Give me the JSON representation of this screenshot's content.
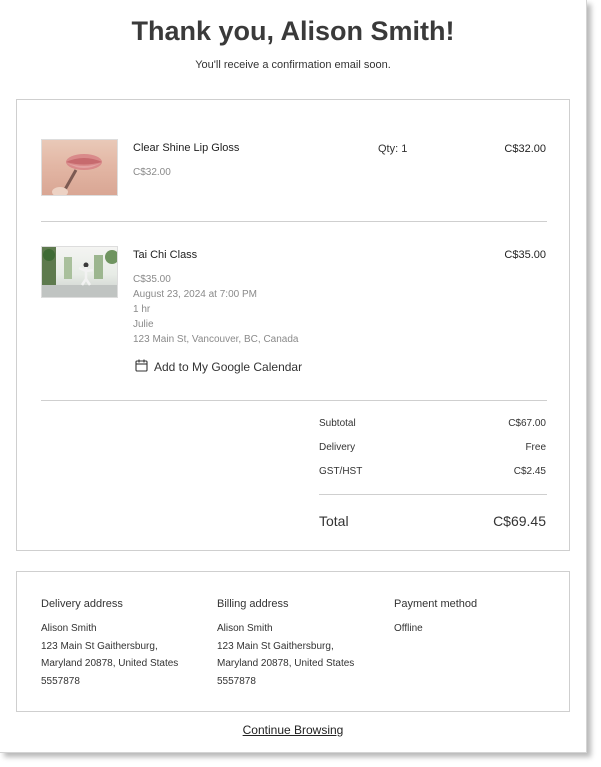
{
  "header": {
    "title": "Thank you, Alison Smith!",
    "subtitle": "You'll receive a confirmation email soon."
  },
  "items": [
    {
      "name": "Clear Shine Lip Gloss",
      "unit_price": "C$32.00",
      "qty": "Qty: 1",
      "total": "C$32.00",
      "image": "lip-gloss-photo"
    },
    {
      "name": "Tai Chi Class",
      "unit_price": "C$35.00",
      "date": "August 23, 2024 at 7:00 PM",
      "duration": "1 hr",
      "staff": "Julie",
      "location": "123 Main St, Vancouver, BC, Canada",
      "total": "C$35.00",
      "image": "tai-chi-photo",
      "calendar_link": "Add to My Google Calendar"
    }
  ],
  "summary": {
    "subtotal_label": "Subtotal",
    "subtotal": "C$67.00",
    "delivery_label": "Delivery",
    "delivery": "Free",
    "tax_label": "GST/HST",
    "tax": "C$2.45",
    "total_label": "Total",
    "total": "C$69.45"
  },
  "delivery_address": {
    "heading": "Delivery address",
    "lines": [
      "Alison Smith",
      "123 Main St Gaithersburg,",
      "Maryland 20878, United States",
      "5557878"
    ]
  },
  "billing_address": {
    "heading": "Billing address",
    "lines": [
      "Alison Smith",
      "123 Main St Gaithersburg,",
      "Maryland 20878, United States",
      "5557878"
    ]
  },
  "payment": {
    "heading": "Payment method",
    "method": "Offline"
  },
  "continue_label": "Continue Browsing"
}
